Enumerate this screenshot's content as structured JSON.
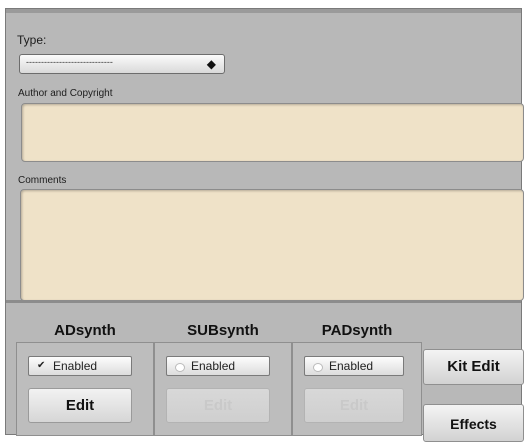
{
  "instrument": {
    "type_label": "Type:",
    "type_value": "-----------------------------",
    "author_label": "Author and Copyright",
    "comments_label": "Comments"
  },
  "engines": [
    {
      "title": "ADsynth",
      "enabled_label": "Enabled",
      "enabled": true,
      "edit_label": "Edit",
      "edit_disabled": false
    },
    {
      "title": "SUBsynth",
      "enabled_label": "Enabled",
      "enabled": false,
      "edit_label": "Edit",
      "edit_disabled": true
    },
    {
      "title": "PADsynth",
      "enabled_label": "Enabled",
      "enabled": false,
      "edit_label": "Edit",
      "edit_disabled": true
    }
  ],
  "buttons": {
    "kit_edit": "Kit Edit",
    "effects": "Effects"
  },
  "icons": {
    "checkmark": "✔",
    "select_arrows": "◆"
  }
}
